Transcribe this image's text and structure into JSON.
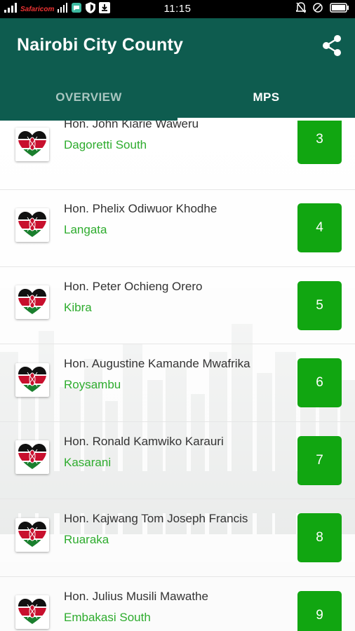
{
  "status_bar": {
    "carrier": "Safaricom",
    "time": "11:15",
    "icons": [
      "signal-icon",
      "signal-icon",
      "message-icon",
      "shield-icon",
      "download-icon",
      "alarm-icon",
      "mute-icon",
      "battery-icon"
    ]
  },
  "app_bar": {
    "title": "Nairobi City County",
    "share_icon": "share-icon",
    "color": "#0e5c4f"
  },
  "tabs": [
    {
      "label": "OVERVIEW",
      "active": false
    },
    {
      "label": "MPS",
      "active": true
    }
  ],
  "mps": [
    {
      "name": "Hon. John Kiarie Waweru",
      "constituency": "Dagoretti South",
      "number": "3"
    },
    {
      "name": "Hon. Phelix Odiwuor Khodhe",
      "constituency": "Langata",
      "number": "4"
    },
    {
      "name": "Hon. Peter Ochieng Orero",
      "constituency": "Kibra",
      "number": "5"
    },
    {
      "name": "Hon. Augustine Kamande Mwafrika",
      "constituency": "Roysambu",
      "number": "6"
    },
    {
      "name": "Hon. Ronald Kamwiko Karauri",
      "constituency": "Kasarani",
      "number": "7"
    },
    {
      "name": "Hon. Kajwang Tom Joseph Francis",
      "constituency": "Ruaraka",
      "number": "8"
    },
    {
      "name": "Hon. Julius Musili Mawathe",
      "constituency": "Embakasi South",
      "number": "9"
    }
  ],
  "colors": {
    "accent_green": "#11a611",
    "constituency_text": "#2eac2e"
  }
}
